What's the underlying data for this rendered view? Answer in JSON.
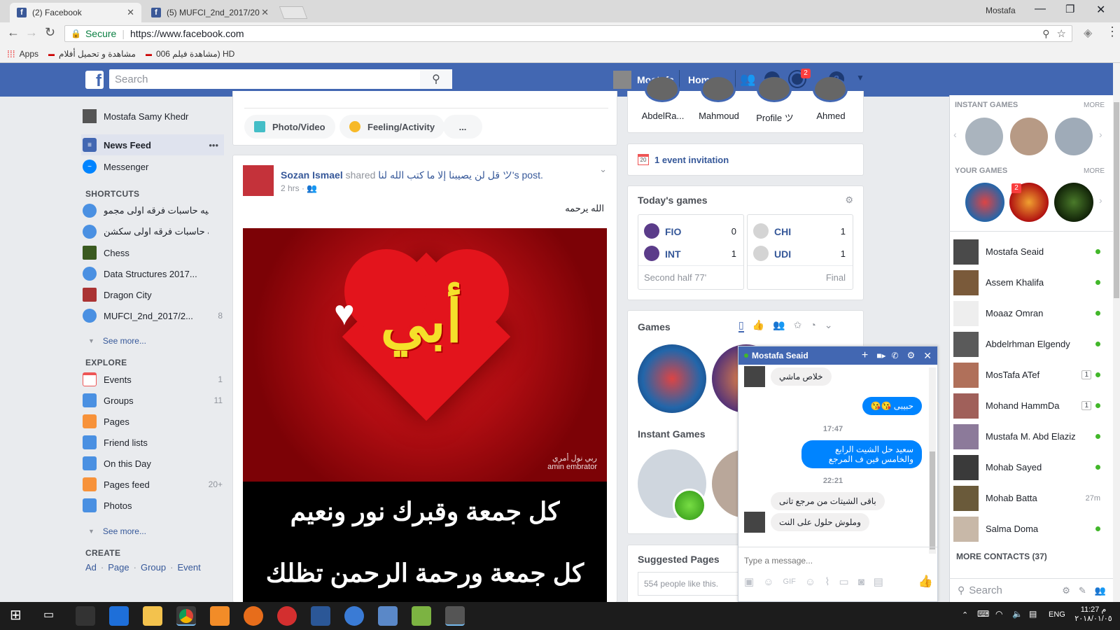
{
  "browser": {
    "tabs": [
      {
        "title": "(2) Facebook"
      },
      {
        "title": "(5) MUFCI_2nd_2017/20"
      }
    ],
    "user": "Mostafa",
    "secure_label": "Secure",
    "url": "https://www.facebook.com",
    "bookmarks": [
      "Apps",
      "مشاهدة و تحميل أفلام",
      "مشاهدة فيلم 006) HD"
    ]
  },
  "header": {
    "search_placeholder": "Search",
    "profile_name": "Mostafa",
    "home": "Home",
    "notif_count": "2"
  },
  "left_nav": {
    "profile": "Mostafa Samy Khedr",
    "news_feed": "News Feed",
    "messenger": "Messenger",
    "shortcuts_title": "SHORTCUTS",
    "shortcuts": [
      {
        "label": "كليه حاسبات فرقه اولى مجمو...",
        "count": ""
      },
      {
        "label": "كليه حاسبات فرقه اولى سكشن...",
        "count": ""
      },
      {
        "label": "Chess",
        "count": ""
      },
      {
        "label": "Data Structures 2017...",
        "count": ""
      },
      {
        "label": "Dragon City",
        "count": ""
      },
      {
        "label": "MUFCI_2nd_2017/2...",
        "count": "8"
      }
    ],
    "see_more": "See more...",
    "explore_title": "EXPLORE",
    "explore": [
      {
        "label": "Events",
        "count": "1"
      },
      {
        "label": "Groups",
        "count": "11"
      },
      {
        "label": "Pages",
        "count": ""
      },
      {
        "label": "Friend lists",
        "count": ""
      },
      {
        "label": "On this Day",
        "count": ""
      },
      {
        "label": "Pages feed",
        "count": "20+"
      },
      {
        "label": "Photos",
        "count": ""
      }
    ],
    "see_more_2": "See more...",
    "create_title": "CREATE",
    "create_links": [
      "Ad",
      "Page",
      "Group",
      "Event"
    ]
  },
  "composer": {
    "photo_video": "Photo/Video",
    "feeling": "Feeling/Activity",
    "more": "..."
  },
  "post": {
    "author": "Sozan Ismael",
    "shared": "shared",
    "target": "قل لن يصيبنا إلا ما كتب الله لنا ツ's",
    "post_word": "post.",
    "time": "2 hrs",
    "text": "الله يرحمه",
    "image_word": "أبي",
    "watermark_1": "ربي نول أمري",
    "watermark_2": "amin embrator",
    "caption_1": "كل جمعة وقبرك نور ونعيم",
    "caption_2": "كل جمعة ورحمة الرحمن تظلك"
  },
  "right_col": {
    "stories": [
      "AbdelRa...",
      "Mahmoud",
      "Profile ツ",
      "Ahmed"
    ],
    "event_invitation": "1 event invitation",
    "event_day": "20",
    "todays_games_title": "Today's games",
    "matches": [
      {
        "home": "FIO",
        "home_score": "0",
        "away": "INT",
        "away_score": "1",
        "status": "Second half 77'"
      },
      {
        "home": "CHI",
        "home_score": "1",
        "away": "UDI",
        "away_score": "1",
        "status": "Final"
      }
    ],
    "games_title": "Games",
    "instant_games_title": "Instant Games",
    "suggested_pages_title": "Suggested Pages",
    "suggested_likes": "554 people like this."
  },
  "chat": {
    "name": "Mostafa Seaid",
    "messages": [
      {
        "from": "them",
        "text": "خلاص ماشي"
      },
      {
        "from": "me",
        "text": "حبيبى 😘😘"
      },
      {
        "time": "17:47"
      },
      {
        "from": "me",
        "text": "سعيد حل الشيت الرابع والخامس فين ف المرجع"
      },
      {
        "time": "22:21"
      },
      {
        "from": "them",
        "text": "باقى الشيتات من مرجع تانى"
      },
      {
        "from": "them",
        "text": "وملوش حلول على النت"
      }
    ],
    "input_placeholder": "Type a message..."
  },
  "sidebar": {
    "instant_games_title": "INSTANT GAMES",
    "more": "MORE",
    "your_games_title": "YOUR GAMES",
    "more_2": "MORE",
    "game_badge": "2",
    "contacts": [
      {
        "name": "Mostafa Seaid",
        "status": "online",
        "extra": ""
      },
      {
        "name": "Assem Khalifa",
        "status": "online",
        "extra": ""
      },
      {
        "name": "Moaaz Omran",
        "status": "online",
        "extra": ""
      },
      {
        "name": "Abdelrhman Elgendy",
        "status": "online",
        "extra": ""
      },
      {
        "name": "MosTafa ATef",
        "status": "online",
        "extra": "1"
      },
      {
        "name": "Mohand HammDa",
        "status": "online",
        "extra": "1"
      },
      {
        "name": "Mustafa M. Abd Elaziz",
        "status": "online",
        "extra": ""
      },
      {
        "name": "Mohab Sayed",
        "status": "online",
        "extra": ""
      },
      {
        "name": "Mohab Batta",
        "status": "away",
        "extra": "27m"
      },
      {
        "name": "Salma Doma",
        "status": "online",
        "extra": ""
      }
    ],
    "more_contacts": "MORE CONTACTS (37)",
    "search_placeholder": "Search"
  },
  "taskbar": {
    "time": "11:27 م",
    "date": "٢٠١٨/٠١/٠٥",
    "lang": "ENG"
  },
  "colors": {
    "fb_blue": "#4267b2",
    "messenger_blue": "#0084ff",
    "online_green": "#42b72a"
  }
}
